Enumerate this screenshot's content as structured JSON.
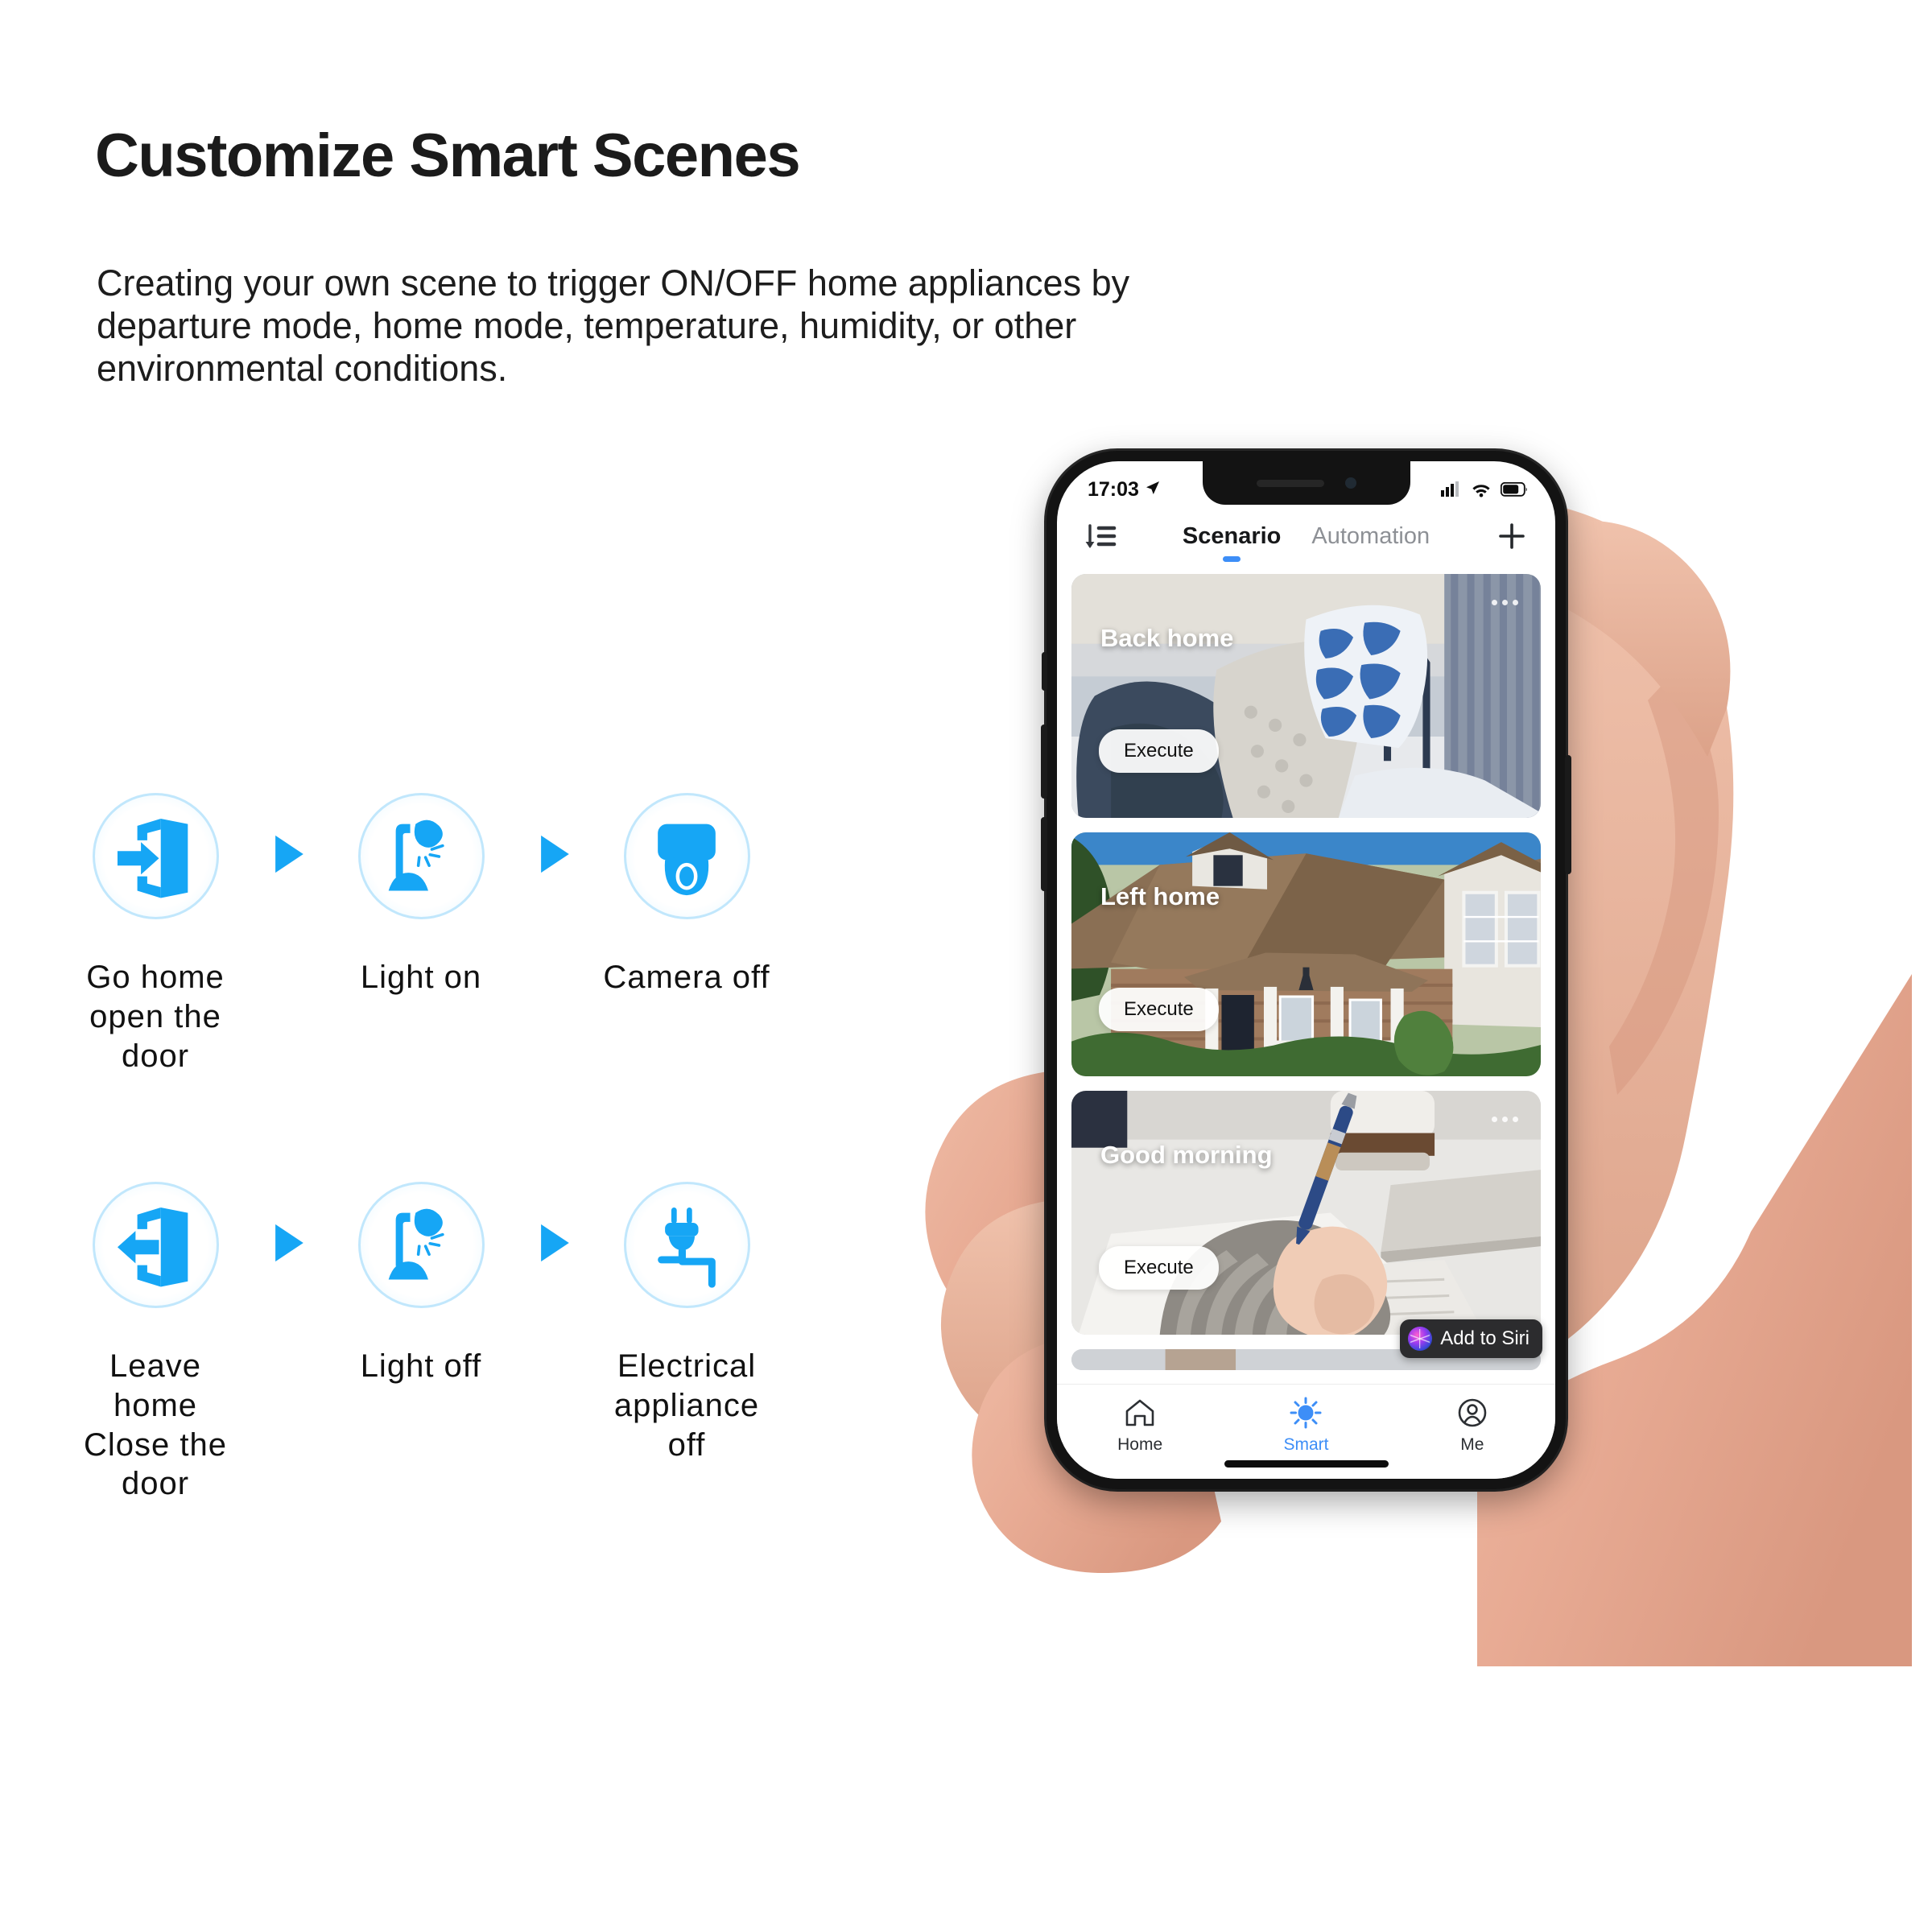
{
  "headline": "Customize Smart Scenes",
  "paragraph": "Creating your own scene to trigger ON/OFF home appliances by departure mode, home mode, temperature, humidity, or other environmental conditions.",
  "accent_blue": "#16a6f5",
  "app_accent_blue": "#3d8ef7",
  "flow_rows": [
    {
      "steps": [
        {
          "icon": "door-enter-icon",
          "label": "Go home\nopen the door"
        },
        {
          "icon": "desk-lamp-on-icon",
          "label": "Light on"
        },
        {
          "icon": "dome-camera-icon",
          "label": "Camera off"
        }
      ],
      "separator_icon": "triangle-right-icon"
    },
    {
      "steps": [
        {
          "icon": "door-exit-icon",
          "label": "Leave home\nClose the door"
        },
        {
          "icon": "desk-lamp-off-icon",
          "label": "Light off"
        },
        {
          "icon": "unplugged-plug-icon",
          "label": "Electrical\nappliance off"
        }
      ],
      "separator_icon": "triangle-right-icon"
    }
  ],
  "phone": {
    "status_bar": {
      "time": "17:03",
      "location_icon": "location-arrow-icon",
      "signal_icon": "cellular-signal-icon",
      "wifi_icon": "wifi-icon",
      "battery_icon": "battery-icon"
    },
    "app_header": {
      "sort_icon": "sort-descending-icon",
      "add_icon": "plus-icon",
      "tabs": [
        {
          "label": "Scenario",
          "active": true
        },
        {
          "label": "Automation",
          "active": false
        }
      ]
    },
    "scene_cards": [
      {
        "title": "Back home",
        "execute_label": "Execute",
        "more_icon": "more-horizontal-icon",
        "art": "bedroom-blanket-chair"
      },
      {
        "title": "Left home",
        "execute_label": "Execute",
        "more_icon": "more-horizontal-icon",
        "art": "suburban-house-exterior"
      },
      {
        "title": "Good morning",
        "execute_label": "Execute",
        "more_icon": "more-horizontal-icon",
        "art": "hand-writing-desk-coffee"
      }
    ],
    "siri_badge": {
      "label": "Add to Siri",
      "icon": "siri-orb-icon"
    },
    "tab_bar": [
      {
        "label": "Home",
        "icon": "house-icon",
        "active": false
      },
      {
        "label": "Smart",
        "icon": "sun-icon",
        "active": true
      },
      {
        "label": "Me",
        "icon": "person-circle-icon",
        "active": false
      }
    ]
  }
}
